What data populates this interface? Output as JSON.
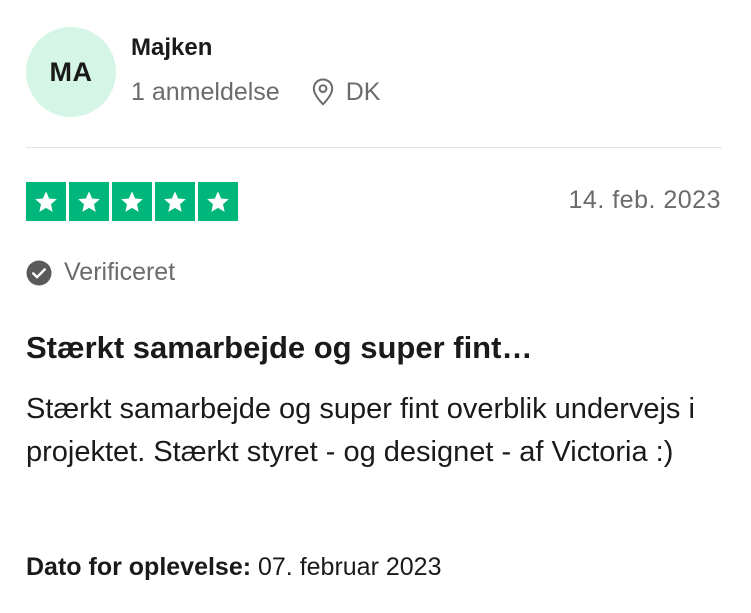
{
  "reviewer": {
    "initials": "MA",
    "name": "Majken",
    "review_count": "1 anmeldelse",
    "location": "DK",
    "location_icon": "location-pin-icon",
    "avatar_color": "#d5f5e6"
  },
  "review": {
    "rating": 5,
    "max_rating": 5,
    "star_color": "#00b67a",
    "star_icon": "star-icon",
    "date": "14. feb. 2023",
    "verified_label": "Verificeret",
    "verified_icon": "check-circle-icon",
    "title": "Stærkt samarbejde og super fint…",
    "body": "Stærkt samarbejde og super fint overblik undervejs i projektet. Stærkt styret - og designet - af Victoria :)",
    "experience_label": "Dato for oplevelse:",
    "experience_date": "07. februar 2023"
  }
}
